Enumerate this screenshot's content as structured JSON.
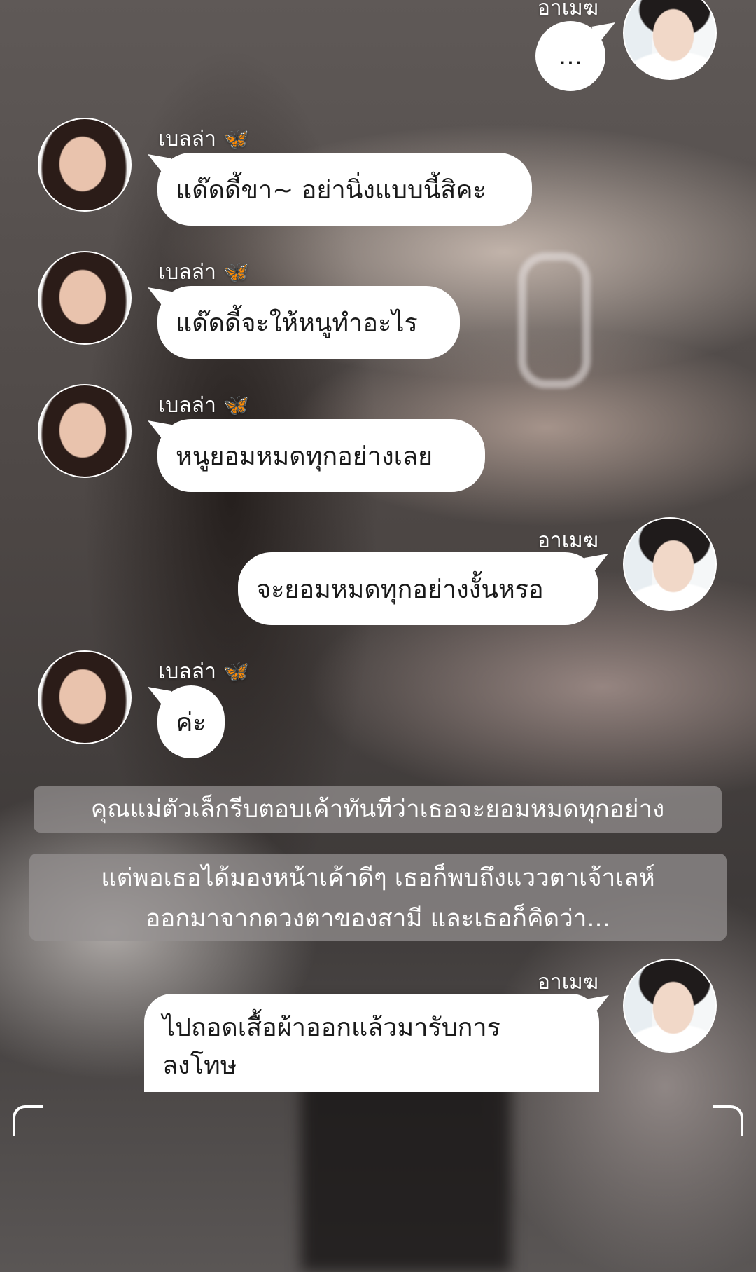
{
  "chat": {
    "participants": {
      "female": {
        "name": "เบลล่า",
        "emoji": "🦋"
      },
      "male": {
        "name": "อาเมฆ"
      }
    },
    "messages": [
      {
        "sender": "male",
        "text": "..."
      },
      {
        "sender": "female",
        "text": "แด๊ดดี้ขา~ อย่านิ่งแบบนี้สิคะ"
      },
      {
        "sender": "female",
        "text": "แด๊ดดี้จะให้หนูทำอะไร"
      },
      {
        "sender": "female",
        "text": "หนูยอมหมดทุกอย่างเลย"
      },
      {
        "sender": "male",
        "text": "จะยอมหมดทุกอย่างงั้นหรอ"
      },
      {
        "sender": "female",
        "text": "ค่ะ"
      },
      {
        "sender": "narration",
        "text": "คุณแม่ตัวเล็กรีบตอบเค้าทันทีว่าเธอจะยอมหมดทุกอย่าง"
      },
      {
        "sender": "narration",
        "text": "แต่พอเธอได้มองหน้าเค้าดีๆ เธอก็พบถึงแววตาเจ้าเลห์ ออกมาจากดวงตาของสามี และเธอก็คิดว่า..."
      },
      {
        "sender": "male",
        "text": "ไปถอดเสื้อผ้าออกแล้วมารับการลงโทษ"
      }
    ]
  },
  "icons": {
    "butterfly": "butterfly-emoji",
    "corner": "bracket-corner-icon"
  }
}
